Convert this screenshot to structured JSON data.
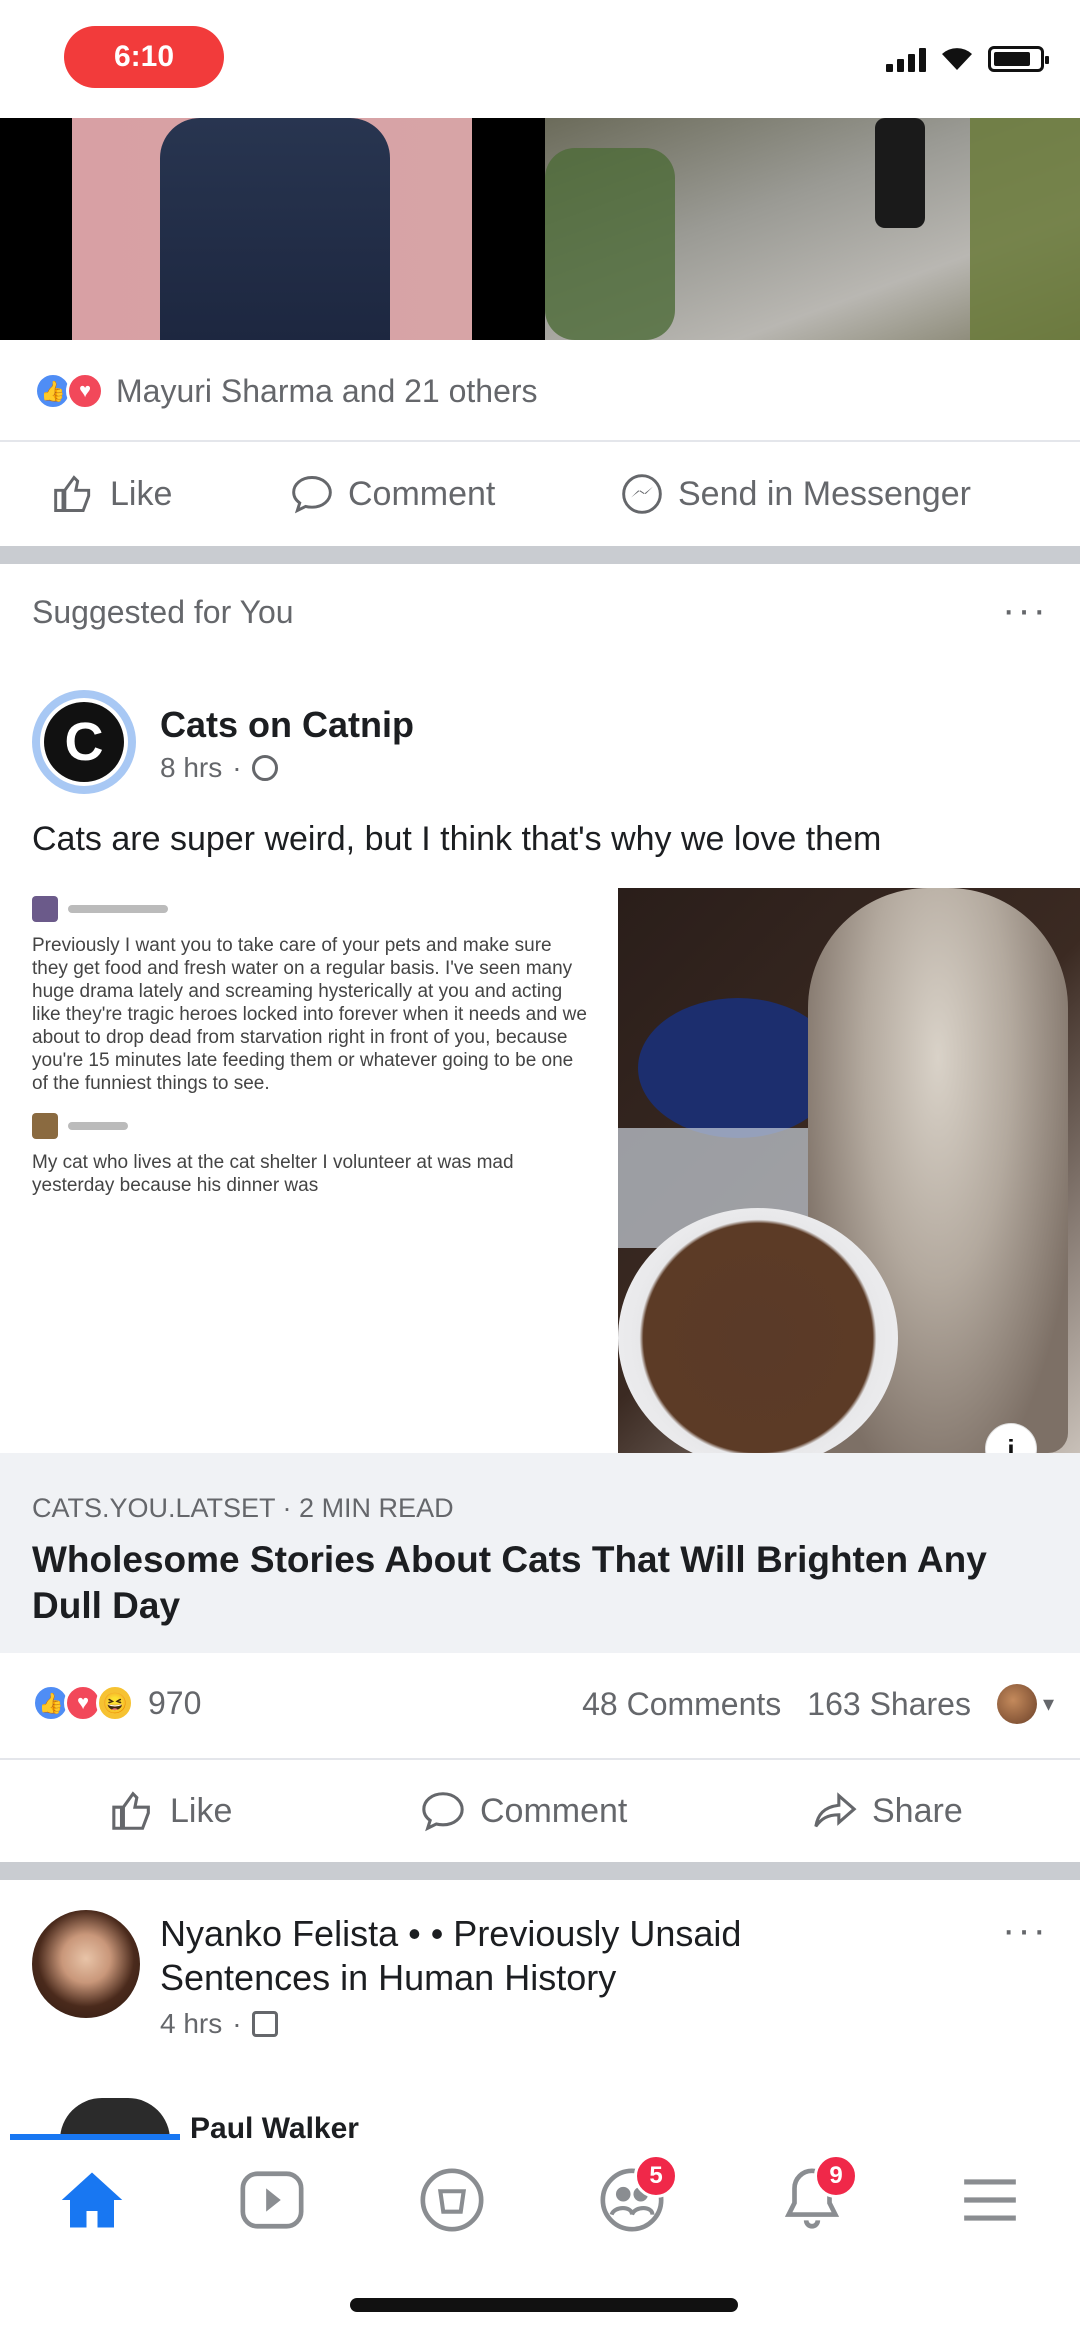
{
  "status_bar": {
    "time": "6:10"
  },
  "prev_post": {
    "reactions_text": "Mayuri Sharma and 21 others",
    "actions": {
      "like": "Like",
      "comment": "Comment",
      "send": "Send in Messenger"
    }
  },
  "suggested": {
    "label": "Suggested for You",
    "more": "···",
    "page_name": "Cats on Catnip",
    "page_avatar_letter": "C",
    "time": "8 hrs",
    "post_text": "Cats are super weird, but I think that's why we love them",
    "article_snippet_1": "Previously I want you to take care of your pets and make sure they get food and fresh water on a regular basis. I've seen many huge drama lately and screaming hysterically at you and acting like they're tragic heroes locked into forever when it needs and we about to drop dead from starvation right in front of you, because you're 15 minutes late feeding them or whatever going to be one of the funniest things to see.",
    "article_snippet_2": "My cat who lives at the cat shelter I volunteer at was mad yesterday because his dinner was",
    "link_domain": "CATS.YOU.LATSET · 2 MIN READ",
    "link_title": "Wholesome Stories About Cats That Will Brighten Any Dull Day",
    "reaction_count": "970",
    "comments": "48 Comments",
    "shares": "163 Shares",
    "actions": {
      "like": "Like",
      "comment": "Comment",
      "share": "Share"
    },
    "info_badge": "i"
  },
  "next_post": {
    "title": "Nyanko Felista • • Previously Unsaid Sentences in Human History",
    "time": "4 hrs",
    "more": "···",
    "peek_name": "Paul Walker"
  },
  "bottom_nav": {
    "items": [
      {
        "name": "home",
        "badge": ""
      },
      {
        "name": "watch",
        "badge": ""
      },
      {
        "name": "marketplace",
        "badge": ""
      },
      {
        "name": "groups",
        "badge": "5"
      },
      {
        "name": "notifications",
        "badge": "9"
      },
      {
        "name": "menu",
        "badge": ""
      }
    ]
  },
  "colors": {
    "accent": "#1877f2",
    "badge": "#f02849",
    "time_pill": "#f23b3b"
  }
}
